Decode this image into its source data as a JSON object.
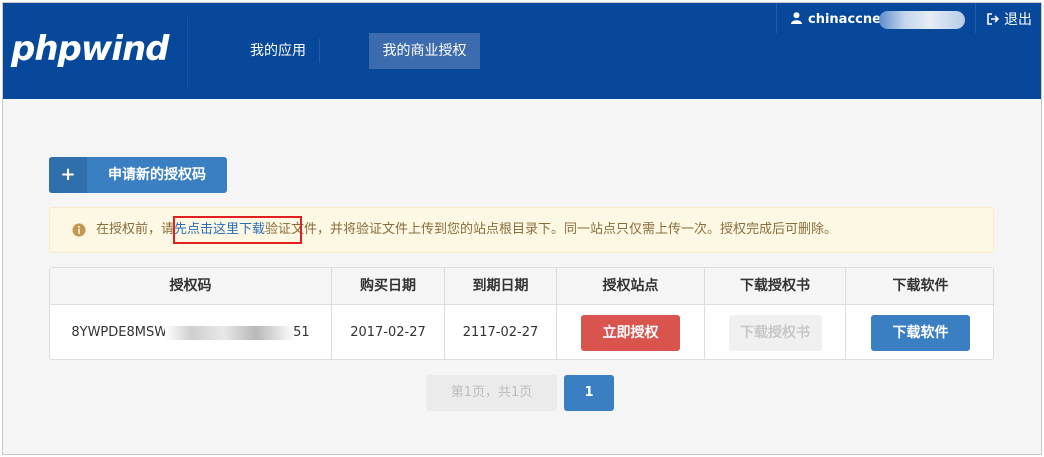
{
  "header": {
    "logo_text": "phpwind",
    "nav": [
      {
        "label": "我的应用"
      },
      {
        "label": "我的商业授权"
      }
    ],
    "user": {
      "name": "chinaccne"
    },
    "logout_label": "退出"
  },
  "actions": {
    "new_code_label": "申请新的授权码"
  },
  "alert": {
    "prefix": "在授权前，请",
    "link": "先点击这里下载",
    "suffix": "验证文件，并将验证文件上传到您的站点根目录下。同一站点只仅需上传一次。授权完成后可删除。"
  },
  "table": {
    "headers": [
      "授权码",
      "购买日期",
      "到期日期",
      "授权站点",
      "下载授权书",
      "下载软件"
    ],
    "rows": [
      {
        "code_start": "8YWPDE8MSW",
        "code_end": "51",
        "purchase_date": "2017-02-27",
        "expire_date": "2117-02-27",
        "authorize_label": "立即授权",
        "download_license_label": "下载授权书",
        "download_software_label": "下载软件"
      }
    ]
  },
  "pagination": {
    "info": "第1页，共1页",
    "current": "1"
  },
  "colors": {
    "header_bg": "#07489a",
    "primary": "#3a7fc1",
    "danger": "#d9534f",
    "warning_bg": "#fcf8e3",
    "warning_text": "#8a6d3b"
  }
}
